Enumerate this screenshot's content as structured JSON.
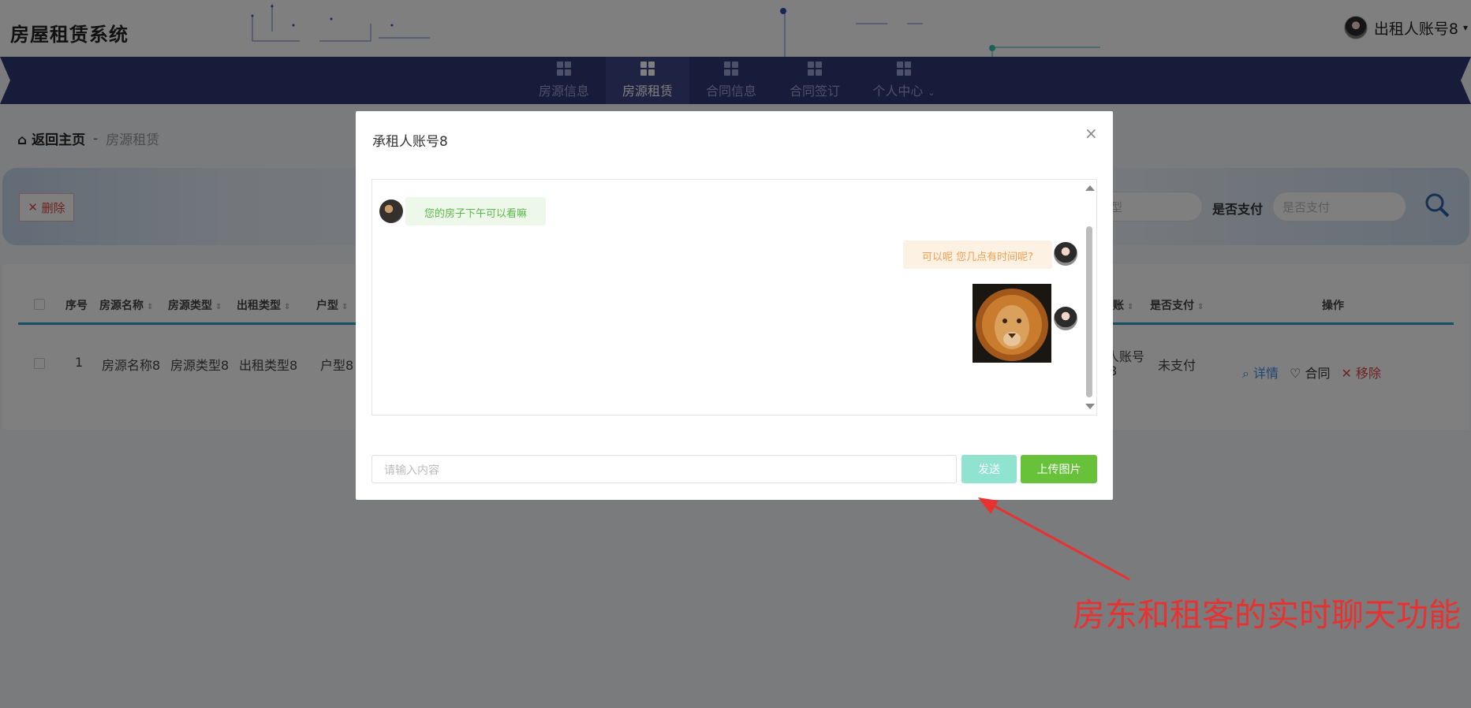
{
  "app": {
    "title": "房屋租赁系统",
    "user_name": "出租人账号8",
    "user_caret": "▾"
  },
  "nav": {
    "items": [
      {
        "label": "房源信息",
        "icon": "house-info-icon",
        "active": false
      },
      {
        "label": "房源租赁",
        "icon": "house-rent-icon",
        "active": true
      },
      {
        "label": "合同信息",
        "icon": "grid-icon",
        "active": false
      },
      {
        "label": "合同签订",
        "icon": "grid-icon",
        "active": false
      },
      {
        "label": "个人中心",
        "icon": "wallet-icon",
        "active": false
      }
    ],
    "dropdown_caret": "⌄",
    "colors": {
      "bar": "#2f3877",
      "active": "#3d4686",
      "text": "#9aa3cf"
    }
  },
  "breadcrumb": {
    "home": "返回主页",
    "separator": "-",
    "current": "房源租赁"
  },
  "search": {
    "delete_label": "删除",
    "type_placeholder_fragment": "类型",
    "paid_label": "是否支付",
    "paid_placeholder": "是否支付"
  },
  "table": {
    "headers": [
      "序号",
      "房源名称",
      "房源类型",
      "出租类型",
      "户型",
      "账",
      "是否支付",
      "操作"
    ],
    "row": {
      "index": "1",
      "name": "房源名称8",
      "type": "房源类型8",
      "rent_type": "出租类型8",
      "layout": "户型8",
      "account_fragment_1": "人账号",
      "account_fragment_2": "8",
      "paid": "未支付"
    },
    "ops": {
      "detail": "详情",
      "contract": "合同",
      "remove": "移除"
    }
  },
  "dialog": {
    "title": "承租人账号8",
    "close": "×",
    "messages": [
      {
        "side": "left",
        "text": "您的房子下午可以看嘛"
      },
      {
        "side": "right",
        "text": "可以呢 您几点有时间呢?"
      },
      {
        "side": "right",
        "image": "lion-image"
      }
    ],
    "input_placeholder": "请输入内容",
    "send_label": "发送",
    "upload_label": "上传图片"
  },
  "annotation": {
    "text": "房东和租客的实时聊天功能",
    "color": "#e83232"
  }
}
